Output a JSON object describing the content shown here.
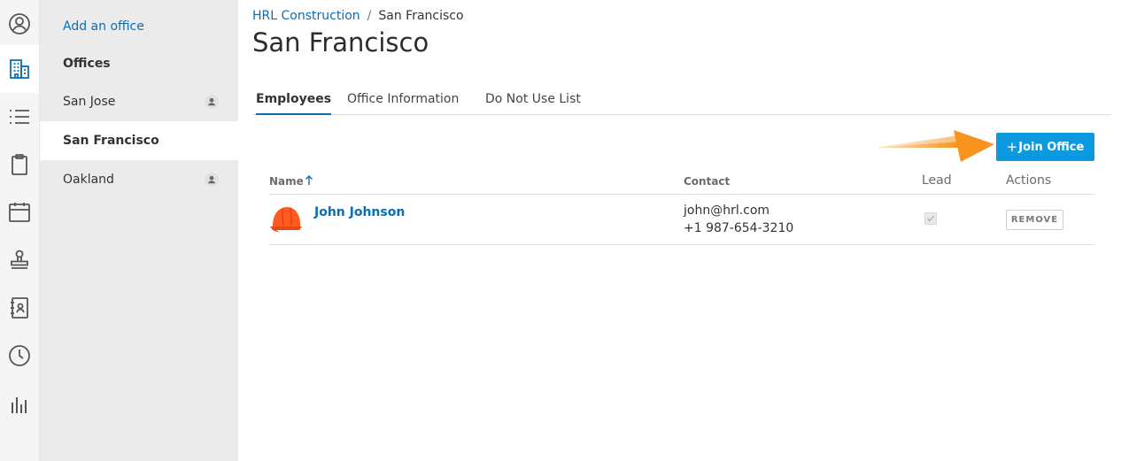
{
  "rail": {
    "items": [
      {
        "icon": "user-circle-icon"
      },
      {
        "icon": "building-icon",
        "active": true
      },
      {
        "icon": "list-icon"
      },
      {
        "icon": "clipboard-icon"
      },
      {
        "icon": "calendar-icon"
      },
      {
        "icon": "stamp-icon"
      },
      {
        "icon": "contacts-book-icon"
      },
      {
        "icon": "clock-icon"
      },
      {
        "icon": "bar-chart-icon"
      }
    ]
  },
  "sidebar": {
    "add_office_label": "Add an office",
    "heading": "Offices",
    "items": [
      {
        "label": "San Jose",
        "icon": "person-icon"
      },
      {
        "label": "San Francisco",
        "active": true
      },
      {
        "label": "Oakland",
        "icon": "person-icon"
      }
    ]
  },
  "breadcrumb": {
    "parent": "HRL Construction",
    "separator": "/",
    "current": "San Francisco"
  },
  "page_title": "San Francisco",
  "tabs": [
    {
      "label": "Employees",
      "active": true
    },
    {
      "label": "Office Information"
    },
    {
      "label": "Do Not Use List"
    }
  ],
  "join_button": {
    "plus": "+",
    "label": "Join Office"
  },
  "table": {
    "columns": {
      "name": "Name",
      "contact": "Contact",
      "lead": "Lead",
      "actions": "Actions"
    },
    "rows": [
      {
        "name": "John Johnson",
        "email": "john@hrl.com",
        "phone": "+1 987-654-3210",
        "lead": true,
        "action_label": "REMOVE"
      }
    ]
  },
  "colors": {
    "accent": "#0b6eb5",
    "button": "#0b9ae0",
    "annotation_arrow": "#f7931e",
    "avatar": "#ff5a1f"
  }
}
